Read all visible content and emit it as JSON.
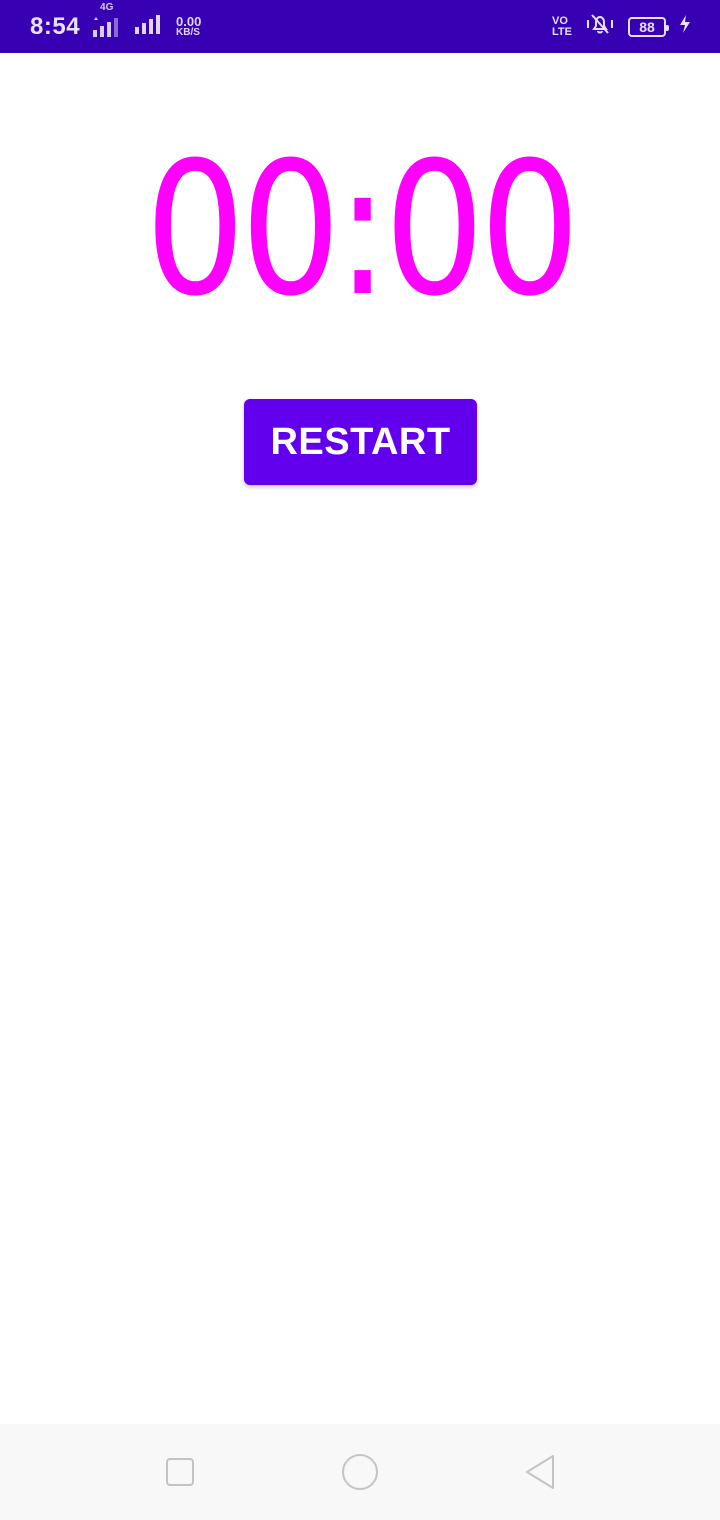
{
  "status_bar": {
    "time": "8:54",
    "network_tag": "4G",
    "speed_value": "0.00",
    "speed_unit": "KB/S",
    "volte_top": "VO",
    "volte_bottom": "LTE",
    "battery_level": "88",
    "icons": [
      "signal-icon",
      "signal-icon",
      "vibrate-icon",
      "battery-icon",
      "charging-icon"
    ],
    "background_color": "#3700B3"
  },
  "timer": {
    "display": "00:00",
    "color": "#FF00FF"
  },
  "restart_button": {
    "label": "RESTART",
    "background_color": "#6200EE"
  },
  "nav_bar": {
    "buttons": [
      "recent-apps-icon",
      "home-icon",
      "back-icon"
    ]
  }
}
